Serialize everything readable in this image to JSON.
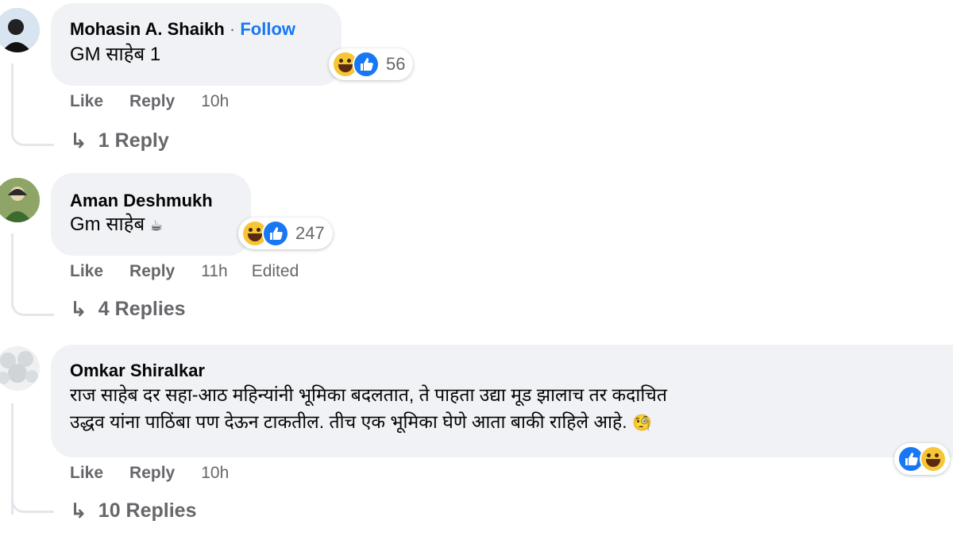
{
  "comments": [
    {
      "author": "Mohasin A. Shaikh",
      "follow_label": "Follow",
      "separator": "·",
      "text": "GM साहेब 1",
      "reaction_count": "56",
      "actions": {
        "like": "Like",
        "reply": "Reply",
        "time": "10h"
      },
      "replies_label": "1 Reply"
    },
    {
      "author": "Aman Deshmukh",
      "text": "Gm साहेब",
      "text_emoji": "☕",
      "reaction_count": "247",
      "actions": {
        "like": "Like",
        "reply": "Reply",
        "time": "11h",
        "edited": "Edited"
      },
      "replies_label": "4 Replies"
    },
    {
      "author": "Omkar Shiralkar",
      "text_line1": "राज साहेब दर सहा-आठ महिन्यांनी भूमिका बदलतात, ते पाहता उद्या मूड झालाच तर कदाचित",
      "text_line2": "उद्धव यांना पाठिंबा पण देऊन टाकतील. तीच एक भूमिका घेणे आता बाकी राहिले आहे.",
      "text_emoji": "🧐",
      "actions": {
        "like": "Like",
        "reply": "Reply",
        "time": "10h"
      },
      "replies_label": "10 Replies"
    }
  ],
  "colors": {
    "bubble": "#f0f2f5",
    "link": "#1877f2",
    "meta": "#65676b"
  },
  "icons": [
    "haha-reaction-icon",
    "like-reaction-icon",
    "reply-arrow-icon"
  ]
}
